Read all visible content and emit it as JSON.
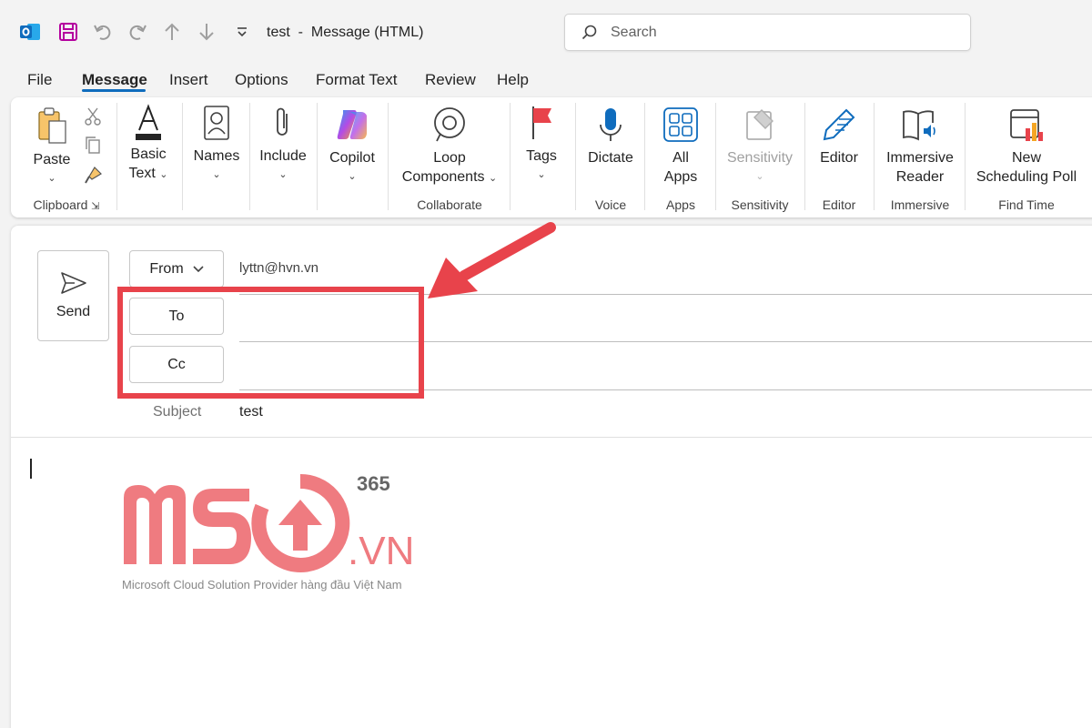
{
  "window": {
    "doc_title": "test  -  Message (HTML)",
    "search_placeholder": "Search"
  },
  "menu": {
    "tabs": [
      "File",
      "Message",
      "Insert",
      "Options",
      "Format Text",
      "Review",
      "Help"
    ],
    "active": "Message"
  },
  "ribbon": {
    "buttons": {
      "paste": "Paste",
      "basic_text_1": "Basic",
      "basic_text_2": "Text",
      "names": "Names",
      "include": "Include",
      "copilot": "Copilot",
      "loop_1": "Loop",
      "loop_2": "Components",
      "tags": "Tags",
      "dictate": "Dictate",
      "all_apps_1": "All",
      "all_apps_2": "Apps",
      "sensitivity": "Sensitivity",
      "editor": "Editor",
      "immersive_1": "Immersive",
      "immersive_2": "Reader",
      "poll_1": "New",
      "poll_2": "Scheduling Poll"
    },
    "groups": {
      "clipboard": "Clipboard",
      "collaborate": "Collaborate",
      "voice": "Voice",
      "apps": "Apps",
      "sensitivity": "Sensitivity",
      "editor": "Editor",
      "immersive": "Immersive",
      "find_time": "Find Time"
    }
  },
  "compose": {
    "send": "Send",
    "from_label": "From",
    "from_email": "lyttn@hvn.vn",
    "to_label": "To",
    "cc_label": "Cc",
    "to_value": "",
    "cc_value": "",
    "subject_label": "Subject",
    "subject_value": "test"
  },
  "logo": {
    "text": "MSO",
    "superscript": "365",
    "suffix": ".VN",
    "tagline": "Microsoft Cloud Solution Provider hàng đầu Việt Nam"
  },
  "colors": {
    "accent": "#0f6cbd",
    "highlight": "#e8434b",
    "logo": "#ef7b80"
  }
}
